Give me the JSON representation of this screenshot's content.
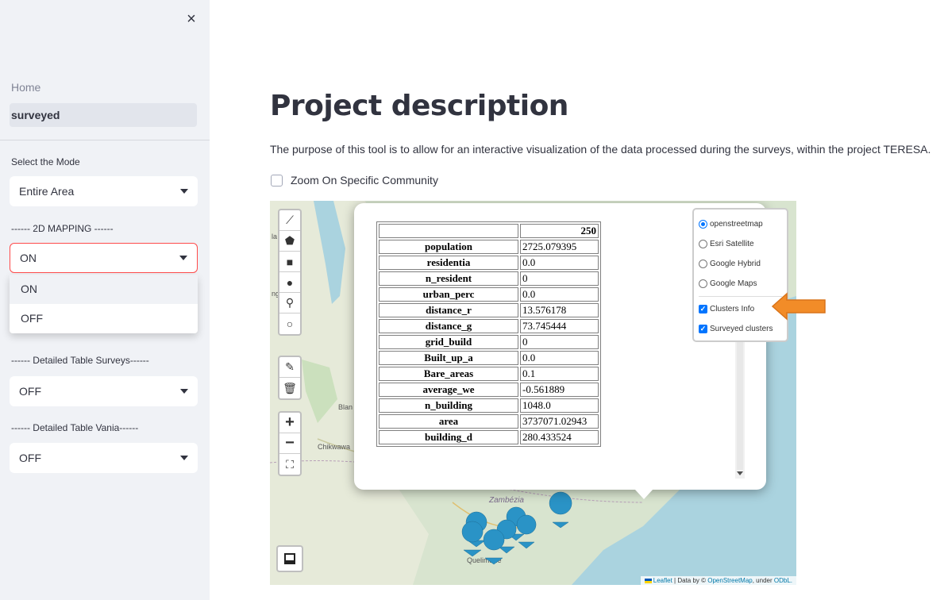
{
  "sidebar": {
    "close_icon": "×",
    "nav": {
      "home": "Home",
      "active": "surveyed"
    },
    "mode": {
      "label": "Select the Mode",
      "value": "Entire Area"
    },
    "mapping_2d": {
      "label": "------ 2D MAPPING ------",
      "value": "ON",
      "options": [
        "ON",
        "OFF"
      ]
    },
    "table_surveys": {
      "label": "------ Detailed Table Surveys------",
      "value": "OFF"
    },
    "table_vania": {
      "label": "------ Detailed Table Vania------",
      "value": "OFF"
    }
  },
  "main": {
    "title": "Project description",
    "description": "The purpose of this tool is to allow for an interactive visualization of the data processed during the surveys, within the project TERESA.",
    "zoom_checkbox": "Zoom On Specific Community"
  },
  "map": {
    "controls": {
      "zoom_in": "+",
      "zoom_out": "−"
    },
    "labels": {
      "chikwawa": "Chikwawa",
      "blantyre": "Blan",
      "zambezia": "Zambézia",
      "quelimane": "Quelimane",
      "edge_la": "la",
      "edge_ng": "ng"
    },
    "popup": {
      "column_header": "250",
      "rows": [
        {
          "key": "population",
          "value": "2725.079395"
        },
        {
          "key": "residentia",
          "value": "0.0"
        },
        {
          "key": "n_resident",
          "value": "0"
        },
        {
          "key": "urban_perc",
          "value": "0.0"
        },
        {
          "key": "distance_r",
          "value": "13.576178"
        },
        {
          "key": "distance_g",
          "value": "73.745444"
        },
        {
          "key": "grid_build",
          "value": "0"
        },
        {
          "key": "Built_up_a",
          "value": "0.0"
        },
        {
          "key": "Bare_areas",
          "value": "0.1"
        },
        {
          "key": "average_we",
          "value": "-0.561889"
        },
        {
          "key": "n_building",
          "value": "1048.0"
        },
        {
          "key": "area",
          "value": "3737071.02943"
        },
        {
          "key": "building_d",
          "value": "280.433524"
        }
      ]
    },
    "layers": {
      "base": [
        {
          "label": "openstreetmap",
          "checked": true
        },
        {
          "label": "Esri Satellite",
          "checked": false
        },
        {
          "label": "Google Hybrid",
          "checked": false
        },
        {
          "label": "Google Maps",
          "checked": false
        }
      ],
      "overlays": [
        {
          "label": "Clusters Info",
          "checked": true
        },
        {
          "label": "Surveyed clusters",
          "checked": true
        }
      ]
    },
    "attribution": {
      "leaflet": "Leaflet",
      "data_by": " | Data by © ",
      "osm": "OpenStreetMap",
      "under": ", under ",
      "odbl": "ODbL."
    }
  },
  "colors": {
    "accent": "#ff4b4b",
    "marker": "#2a93c6",
    "arrow": "#f28c28",
    "sidebar_bg": "#f0f2f6"
  }
}
